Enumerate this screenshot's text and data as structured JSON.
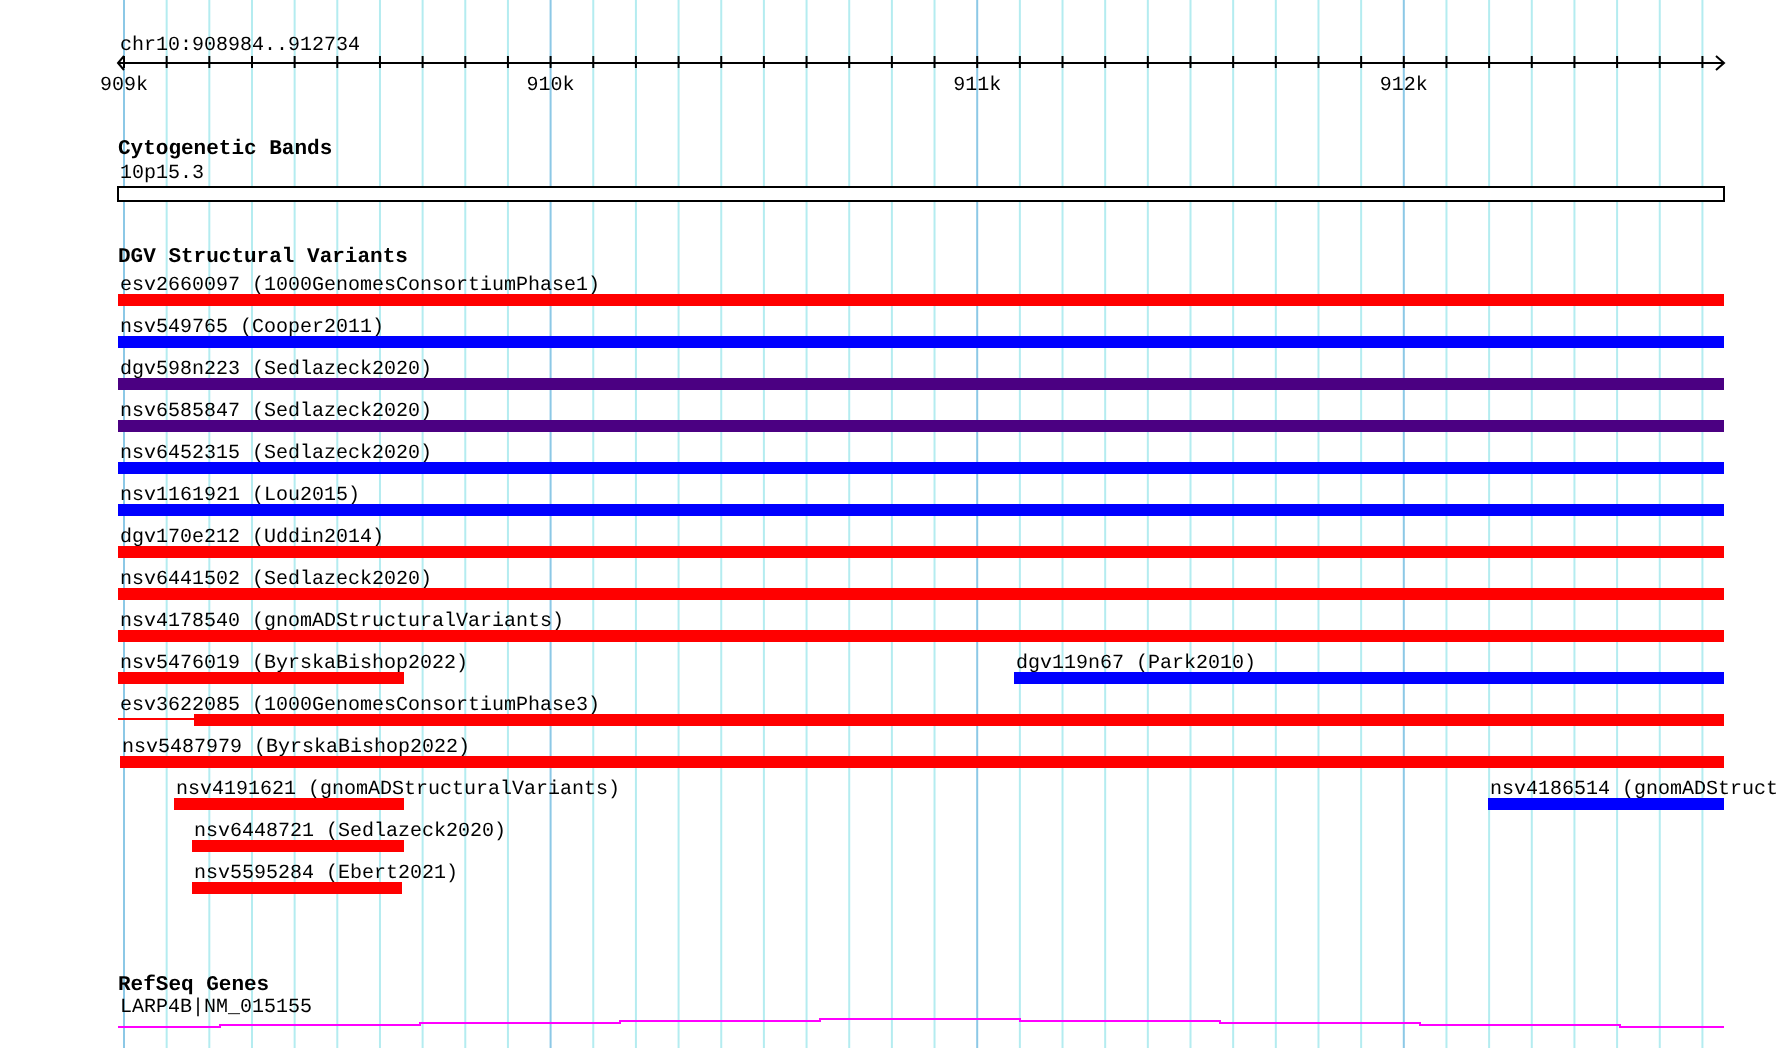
{
  "ruler": {
    "location": "chr10:908984..912734",
    "ticks": [
      "909k",
      "910k",
      "911k",
      "912k"
    ]
  },
  "tracks": [
    {
      "title": "Cytogenetic Bands",
      "kind": "bands",
      "features": [
        {
          "label": "10p15.3"
        }
      ]
    },
    {
      "title": "DGV Structural Variants",
      "kind": "variants",
      "features": [
        {
          "label": "esv2660097 (1000GenomesConsortiumPhase1)",
          "color": "#ff0000"
        },
        {
          "label": "nsv549765 (Cooper2011)",
          "color": "#0000ff"
        },
        {
          "label": "dgv598n223 (Sedlazeck2020)",
          "color": "#4b0082"
        },
        {
          "label": "nsv6585847 (Sedlazeck2020)",
          "color": "#4b0082"
        },
        {
          "label": "nsv6452315 (Sedlazeck2020)",
          "color": "#0000ff"
        },
        {
          "label": "nsv1161921 (Lou2015)",
          "color": "#0000ff"
        },
        {
          "label": "dgv170e212 (Uddin2014)",
          "color": "#ff0000"
        },
        {
          "label": "nsv6441502 (Sedlazeck2020)",
          "color": "#ff0000"
        },
        {
          "label": "nsv4178540 (gnomADStructuralVariants)",
          "color": "#ff0000"
        },
        {
          "label": "nsv5476019 (ByrskaBishop2022)",
          "color": "#ff0000"
        },
        {
          "label": "dgv119n67 (Park2010)",
          "color": "#0000ff"
        },
        {
          "label": "esv3622085 (1000GenomesConsortiumPhase3)",
          "color": "#ff0000"
        },
        {
          "label": "nsv5487979 (ByrskaBishop2022)",
          "color": "#ff0000"
        },
        {
          "label": "nsv4191621 (gnomADStructuralVariants)",
          "color": "#ff0000"
        },
        {
          "label": "nsv4186514 (gnomADStruct",
          "color": "#0000ff"
        },
        {
          "label": "nsv6448721 (Sedlazeck2020)",
          "color": "#ff0000"
        },
        {
          "label": "nsv5595284 (Ebert2021)",
          "color": "#ff0000"
        }
      ]
    },
    {
      "title": "RefSeq Genes",
      "kind": "genes",
      "features": [
        {
          "label": "LARP4B|NM_015155"
        }
      ]
    }
  ]
}
